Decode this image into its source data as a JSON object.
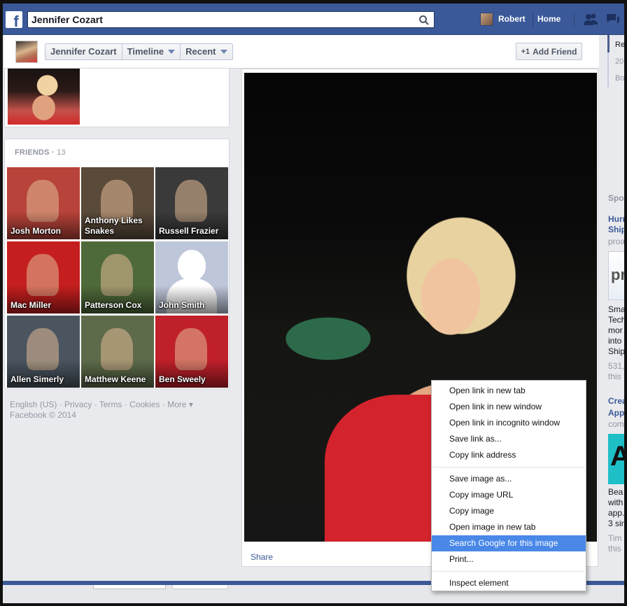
{
  "topbar": {
    "logo": "f",
    "search_value": "Jennifer Cozart",
    "user_name": "Robert",
    "home_label": "Home"
  },
  "timeline_bar": {
    "name_button": "Jennifer Cozart",
    "timeline_button": "Timeline",
    "recent_button": "Recent",
    "add_friend_icon": "+1",
    "add_friend_label": "Add Friend"
  },
  "friends": {
    "heading": "FRIENDS",
    "separator": " · ",
    "count": "13",
    "items": [
      {
        "name": "Josh Morton",
        "bg": "#b8433a"
      },
      {
        "name": "Anthony Likes Snakes",
        "bg": "#5a4a3a"
      },
      {
        "name": "Russell Frazier",
        "bg": "#3a3a3a"
      },
      {
        "name": "Mac Miller",
        "bg": "#c41e1e"
      },
      {
        "name": "Patterson Cox",
        "bg": "#4f6a3a"
      },
      {
        "name": "John Smith",
        "bg": "#bec6d9"
      },
      {
        "name": "Allen Simerly",
        "bg": "#4a5560"
      },
      {
        "name": "Matthew Keene",
        "bg": "#5d6b4a"
      },
      {
        "name": "Ben Sweely",
        "bg": "#c0202a"
      }
    ]
  },
  "footer": {
    "english": "English (US)",
    "privacy": "Privacy",
    "terms": "Terms",
    "cookies": "Cookies",
    "more": "More",
    "copyright": "Facebook © 2014",
    "dot": " · "
  },
  "photo": {
    "share_label": "Share"
  },
  "rail": {
    "top_items": [
      "Re",
      "20",
      "Bo"
    ],
    "sponsored": "Spo",
    "ad1": {
      "title_lines": [
        "Hurr",
        "Ship"
      ],
      "source": "proa",
      "logo_text": "pr",
      "body_lines": [
        "Sma",
        "Tech",
        "mor",
        "into",
        "Ship"
      ],
      "stats_lines": [
        "531,",
        "this"
      ]
    },
    "ad2": {
      "title_lines": [
        "Crea",
        "App"
      ],
      "source": "com",
      "logo_text": "A",
      "body_lines": [
        "Bea",
        "with",
        "app.",
        "3 sin"
      ],
      "stats_lines": [
        "Tim",
        "this"
      ]
    }
  },
  "context_menu": {
    "group1": [
      "Open link in new tab",
      "Open link in new window",
      "Open link in incognito window",
      "Save link as...",
      "Copy link address"
    ],
    "group2": [
      "Save image as...",
      "Copy image URL",
      "Copy image",
      "Open image in new tab",
      "Search Google for this image",
      "Print..."
    ],
    "group3": [
      "Inspect element"
    ],
    "highlighted": "Search Google for this image"
  }
}
